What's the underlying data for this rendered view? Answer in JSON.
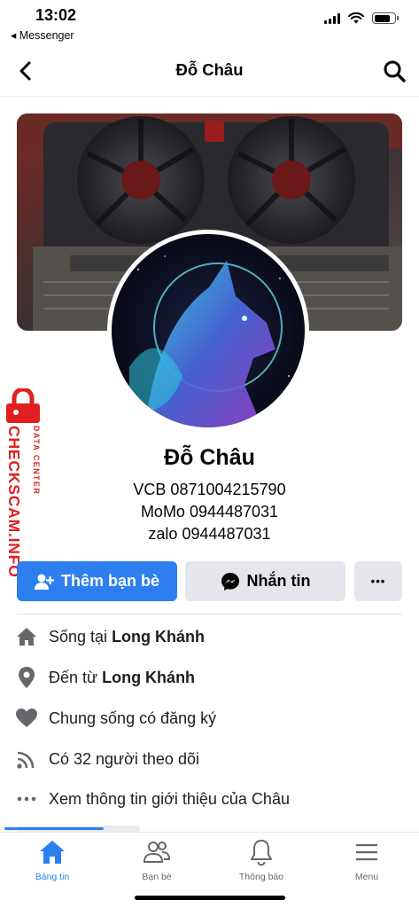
{
  "status": {
    "time": "13:02",
    "back_app": "◂ Messenger"
  },
  "nav": {
    "title": "Đỗ Châu",
    "back_icon": "chevron-left-icon",
    "search_icon": "search-icon"
  },
  "profile": {
    "name": "Đỗ Châu",
    "bio_lines": [
      "VCB 0871004215790",
      "MoMo 0944487031",
      "zalo 0944487031"
    ]
  },
  "actions": {
    "add_friend": "Thêm bạn bè",
    "message": "Nhắn tin",
    "more": "•••"
  },
  "watermark": {
    "main": "CHECKSCAM.INFO",
    "sub": "DATA CENTER",
    "color": "#e02020"
  },
  "info": {
    "lives_in_prefix": "Sống tại",
    "lives_in_place": "Long Khánh",
    "from_prefix": "Đến từ",
    "from_place": "Long Khánh",
    "relationship": "Chung sống có đăng ký",
    "followers": "Có 32 người theo dõi",
    "see_about": "Xem thông tin giới thiệu của Châu"
  },
  "tabs": [
    {
      "label": "Bảng tin",
      "icon": "home-icon",
      "active": true
    },
    {
      "label": "Bạn bè",
      "icon": "friends-icon",
      "active": false
    },
    {
      "label": "Thông báo",
      "icon": "bell-icon",
      "active": false
    },
    {
      "label": "Menu",
      "icon": "menu-icon",
      "active": false
    }
  ],
  "colors": {
    "primary": "#2d7ff0",
    "button_gray": "#e4e6eb",
    "text": "#050505"
  }
}
